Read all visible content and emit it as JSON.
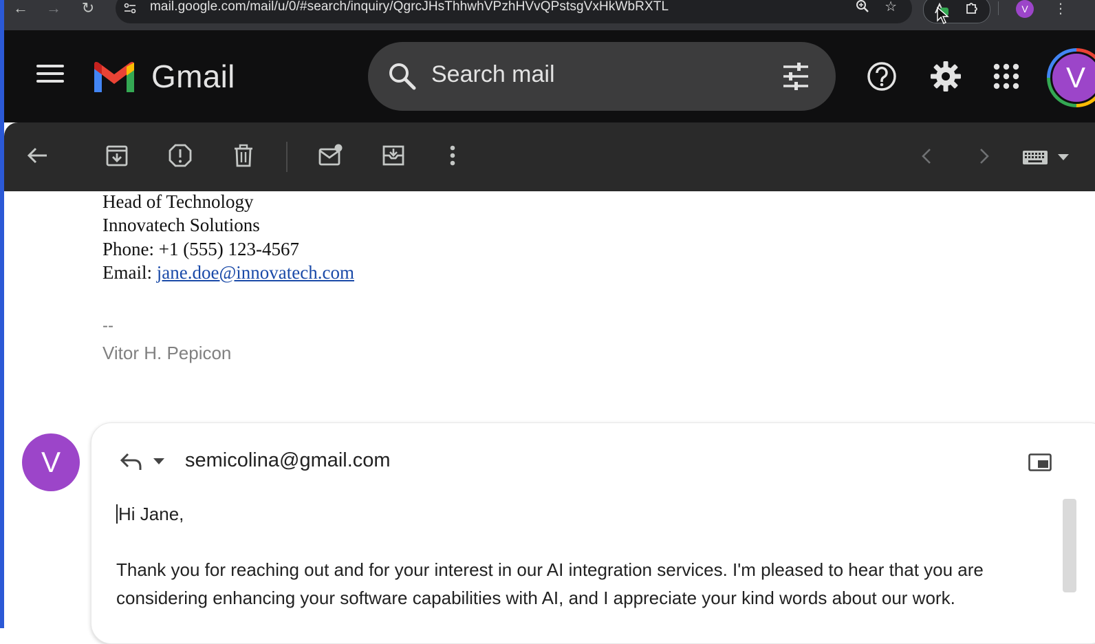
{
  "browser": {
    "url": "mail.google.com/mail/u/0/#search/inquiry/QgrcJHsThhwhVPzhHVvQPstsgVxHkWbRXTL",
    "profile_initial": "V"
  },
  "gmail": {
    "app_name": "Gmail",
    "search_placeholder": "Search mail",
    "account_initial": "V"
  },
  "signature_block": {
    "role": "Head of Technology",
    "company": "Innovatech Solutions",
    "phone_label": "Phone: +1 (555) 123-4567",
    "email_prefix": "Email: ",
    "email_link": "jane.doe@innovatech.com",
    "separator": "--",
    "sender_name": "Vitor H. Pepicon"
  },
  "reply": {
    "avatar_initial": "V",
    "to_address": "semicolina@gmail.com",
    "greeting": "Hi Jane,",
    "paragraph": "Thank you for reaching out and for your interest in our AI integration services. I'm pleased to hear that you are considering enhancing your software capabilities with AI, and I appreciate your kind words about our work."
  },
  "colors": {
    "avatar": "#9c45c9",
    "header_bg": "#0f0f10",
    "toolbar_bg": "#2a2a2a",
    "link": "#1a4aa8"
  }
}
